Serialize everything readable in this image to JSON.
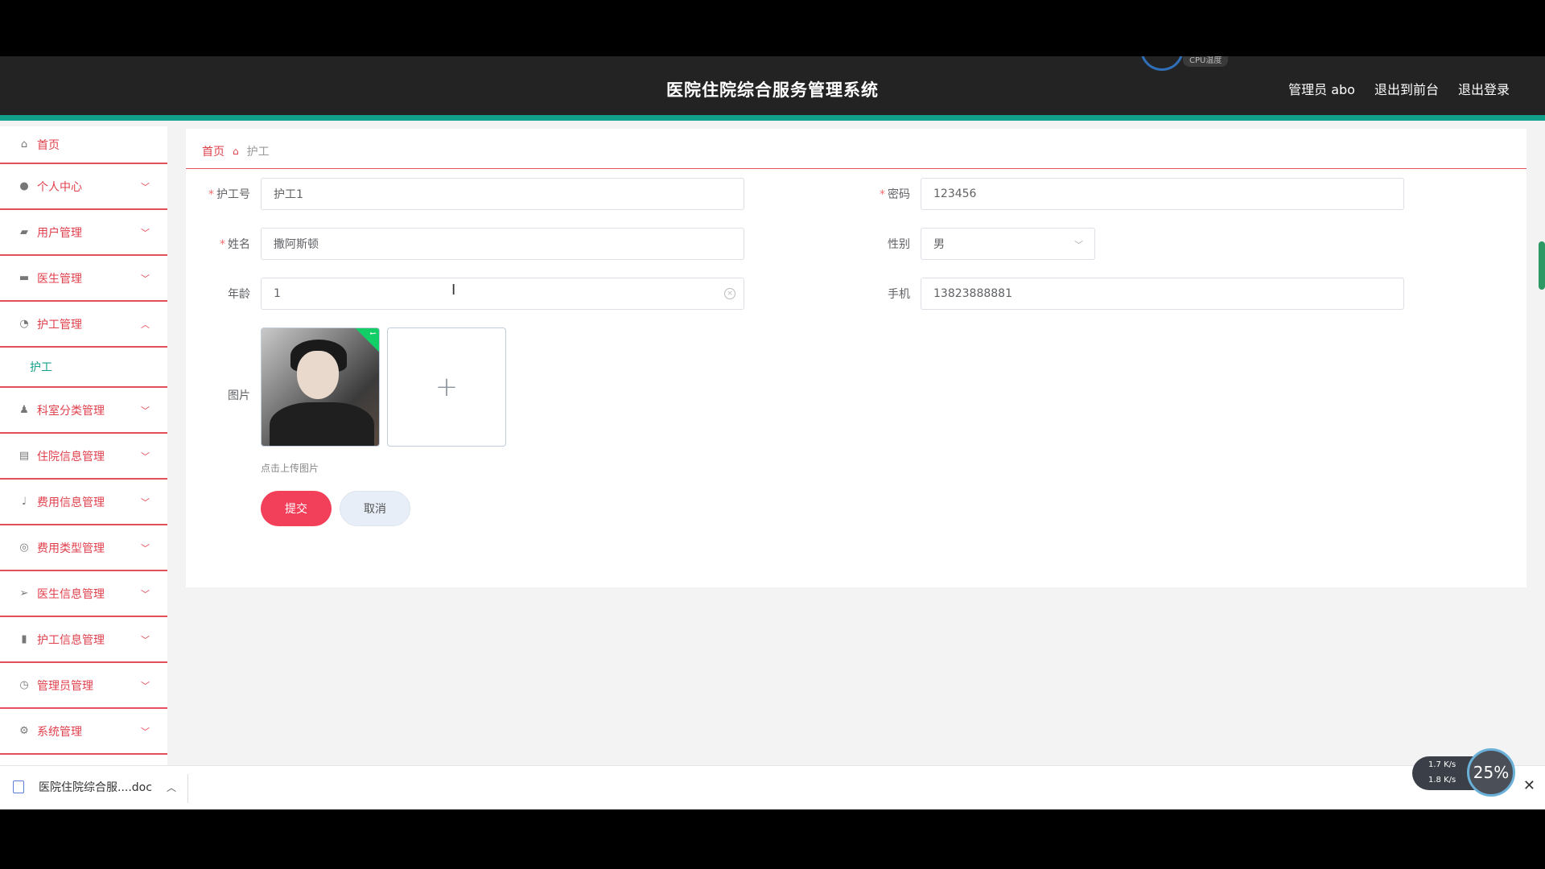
{
  "header": {
    "title": "医院住院综合服务管理系统",
    "cpu_label": "CPU温度",
    "user": "管理员 abo",
    "to_front": "退出到前台",
    "logout": "退出登录"
  },
  "sidebar": {
    "items": [
      {
        "label": "首页",
        "icon": "home-icon"
      },
      {
        "label": "个人中心",
        "icon": "user-icon"
      },
      {
        "label": "用户管理",
        "icon": "ticket-icon"
      },
      {
        "label": "医生管理",
        "icon": "monitor-icon"
      },
      {
        "label": "护工管理",
        "icon": "gauge-icon"
      },
      {
        "label": "科室分类管理",
        "icon": "person-icon"
      },
      {
        "label": "住院信息管理",
        "icon": "chat-icon"
      },
      {
        "label": "费用信息管理",
        "icon": "mic-icon"
      },
      {
        "label": "费用类型管理",
        "icon": "compass-icon"
      },
      {
        "label": "医生信息管理",
        "icon": "send-icon"
      },
      {
        "label": "护工信息管理",
        "icon": "chart-icon"
      },
      {
        "label": "管理员管理",
        "icon": "clock-icon"
      },
      {
        "label": "系统管理",
        "icon": "settings-icon"
      }
    ],
    "sub_item": "护工"
  },
  "breadcrumb": {
    "home": "首页",
    "current": "护工"
  },
  "form": {
    "nurse_no": {
      "label": "护工号",
      "value": "护工1"
    },
    "password": {
      "label": "密码",
      "value": "123456"
    },
    "name": {
      "label": "姓名",
      "value": "撒阿斯顿"
    },
    "gender": {
      "label": "性别",
      "value": "男"
    },
    "age": {
      "label": "年龄",
      "value": "1"
    },
    "phone": {
      "label": "手机",
      "value": "13823888881"
    },
    "image": {
      "label": "图片",
      "tip": "点击上传图片"
    },
    "submit": "提交",
    "cancel": "取消"
  },
  "downloads": {
    "file": "医院住院综合服....doc"
  },
  "net": {
    "up": "1.7 K/s",
    "down": "1.8 K/s",
    "percent": "25%"
  }
}
